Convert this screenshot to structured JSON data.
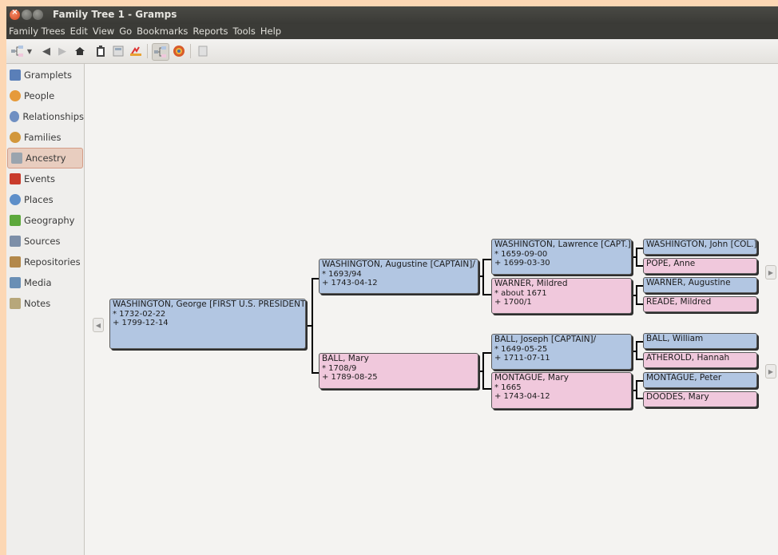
{
  "window": {
    "title": "Family Tree 1 - Gramps"
  },
  "menu": [
    "Family Trees",
    "Edit",
    "View",
    "Go",
    "Bookmarks",
    "Reports",
    "Tools",
    "Help"
  ],
  "sidebar": {
    "items": [
      {
        "label": "Gramplets",
        "icon": "gramplets-icon",
        "color": "#5a7fb8"
      },
      {
        "label": "People",
        "icon": "person-icon",
        "color": "#e69a3a"
      },
      {
        "label": "Relationships",
        "icon": "relationships-icon",
        "color": "#6f8fc2"
      },
      {
        "label": "Families",
        "icon": "families-icon",
        "color": "#d2973c"
      },
      {
        "label": "Ancestry",
        "icon": "ancestry-icon",
        "color": "#9aa4ae",
        "active": true
      },
      {
        "label": "Events",
        "icon": "events-icon",
        "color": "#c93b2b"
      },
      {
        "label": "Places",
        "icon": "places-icon",
        "color": "#5e8fc9"
      },
      {
        "label": "Geography",
        "icon": "geography-icon",
        "color": "#5da83c"
      },
      {
        "label": "Sources",
        "icon": "sources-icon",
        "color": "#7d8fa8"
      },
      {
        "label": "Repositories",
        "icon": "repositories-icon",
        "color": "#b3884a"
      },
      {
        "label": "Media",
        "icon": "media-icon",
        "color": "#6a8fb5"
      },
      {
        "label": "Notes",
        "icon": "notes-icon",
        "color": "#b7a77a"
      }
    ]
  },
  "tree": {
    "p0": {
      "name": "WASHINGTON, George [FIRST U.S. PRESIDENT]",
      "birth": "* 1732-02-22",
      "death": "+ 1799-12-14"
    },
    "p1": {
      "name": "WASHINGTON, Augustine [CAPTAIN]/",
      "birth": "* 1693/94",
      "death": "+ 1743-04-12"
    },
    "p2": {
      "name": "BALL, Mary",
      "birth": "* 1708/9",
      "death": "+ 1789-08-25"
    },
    "p3": {
      "name": "WASHINGTON, Lawrence [CAPT.]",
      "birth": "* 1659-09-00",
      "death": "+ 1699-03-30"
    },
    "p4": {
      "name": "WARNER, Mildred",
      "birth": "* about 1671",
      "death": "+ 1700/1"
    },
    "p5": {
      "name": "BALL, Joseph [CAPTAIN]/",
      "birth": "* 1649-05-25",
      "death": "+ 1711-07-11"
    },
    "p6": {
      "name": "MONTAGUE, Mary",
      "birth": "* 1665",
      "death": "+ 1743-04-12"
    },
    "p7": {
      "name": "WASHINGTON, John [COL.]"
    },
    "p8": {
      "name": "POPE, Anne"
    },
    "p9": {
      "name": "WARNER, Augustine"
    },
    "p10": {
      "name": "READE, Mildred"
    },
    "p11": {
      "name": "BALL, William"
    },
    "p12": {
      "name": "ATHEROLD, Hannah"
    },
    "p13": {
      "name": "MONTAGUE, Peter"
    },
    "p14": {
      "name": "DOODES, Mary"
    }
  },
  "colors": {
    "male": "#b2c6e2",
    "female": "#f0c8dc"
  }
}
